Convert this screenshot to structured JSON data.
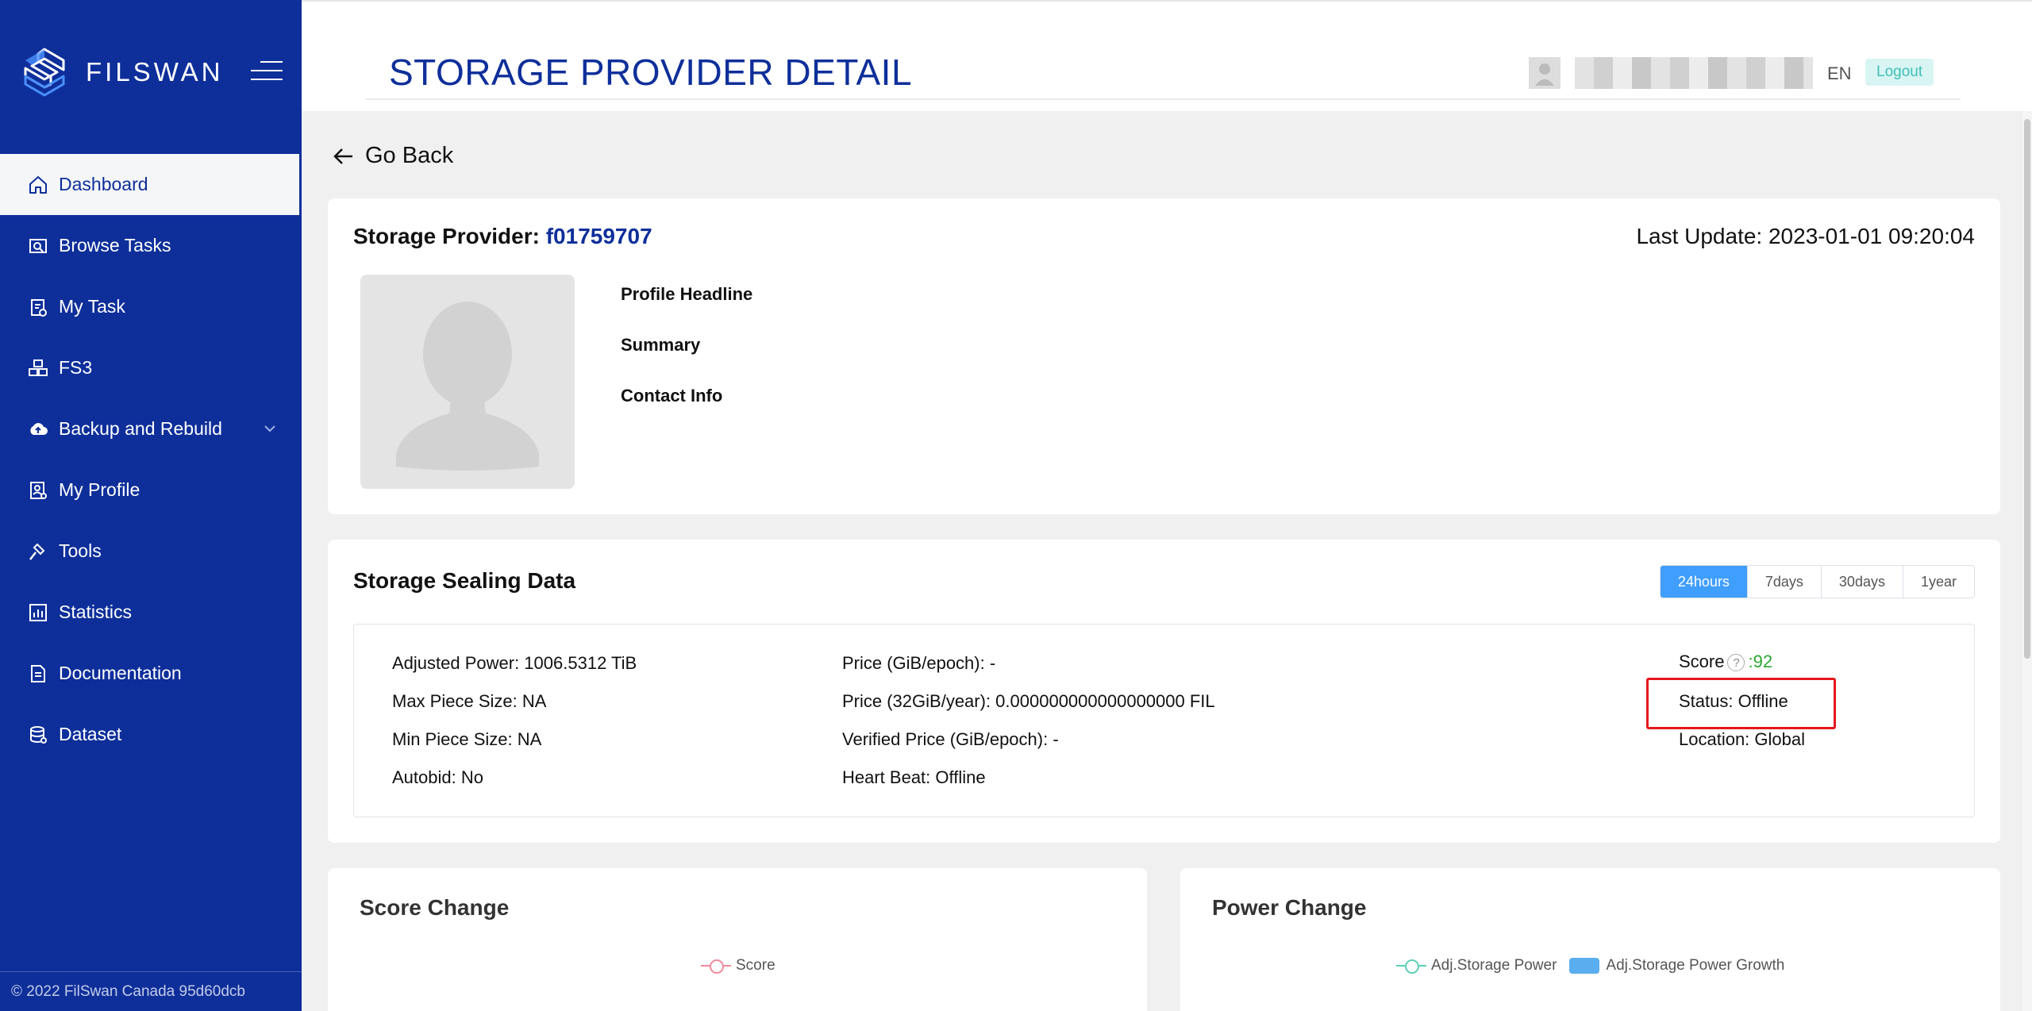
{
  "brand": {
    "name": "FILSWAN"
  },
  "sidebar": {
    "items": [
      {
        "label": "Dashboard",
        "icon": "home-icon"
      },
      {
        "label": "Browse Tasks",
        "icon": "browse-icon"
      },
      {
        "label": "My Task",
        "icon": "clipboard-icon"
      },
      {
        "label": "FS3",
        "icon": "boxes-icon"
      },
      {
        "label": "Backup and Rebuild",
        "icon": "cloud-upload-icon"
      },
      {
        "label": "My Profile",
        "icon": "profile-icon"
      },
      {
        "label": "Tools",
        "icon": "hammer-icon"
      },
      {
        "label": "Statistics",
        "icon": "chart-icon"
      },
      {
        "label": "Documentation",
        "icon": "document-icon"
      },
      {
        "label": "Dataset",
        "icon": "database-icon"
      }
    ],
    "active_index": 0,
    "footer": "© 2022 FilSwan Canada 95d60dcb"
  },
  "header": {
    "title": "STORAGE PROVIDER DETAIL",
    "lang": "EN",
    "logout": "Logout"
  },
  "nav": {
    "go_back": "Go Back"
  },
  "provider": {
    "label": "Storage Provider: ",
    "id": "f01759707",
    "last_update": "Last Update: 2023-01-01 09:20:04",
    "fields": [
      "Profile Headline",
      "Summary",
      "Contact Info"
    ]
  },
  "sealing": {
    "title": "Storage Sealing Data",
    "tabs": [
      "24hours",
      "7days",
      "30days",
      "1year"
    ],
    "active_tab": 0,
    "col1": [
      "Adjusted Power: 1006.5312 TiB",
      "Max Piece Size: NA",
      "Min Piece Size: NA",
      "Autobid: No"
    ],
    "col2": [
      "Price (GiB/epoch): -",
      "Price (32GiB/year): 0.000000000000000000 FIL",
      "Verified Price (GiB/epoch): -",
      "Heart Beat: Offline"
    ],
    "score_label": "Score",
    "score_value": ":92",
    "status": "Status: Offline",
    "location": "Location: Global"
  },
  "score_chart": {
    "title": "Score Change",
    "legend": [
      "Score"
    ],
    "color": "#f08a9b"
  },
  "power_chart": {
    "title": "Power Change",
    "legend": [
      "Adj.Storage Power",
      "Adj.Storage Power Growth"
    ],
    "colors": [
      "#5fd0b6",
      "#5aaeef"
    ]
  },
  "colors": {
    "primary": "#0e2f9a",
    "accent": "#409eff",
    "score_green": "#2aa831",
    "highlight": "#e5181c"
  }
}
